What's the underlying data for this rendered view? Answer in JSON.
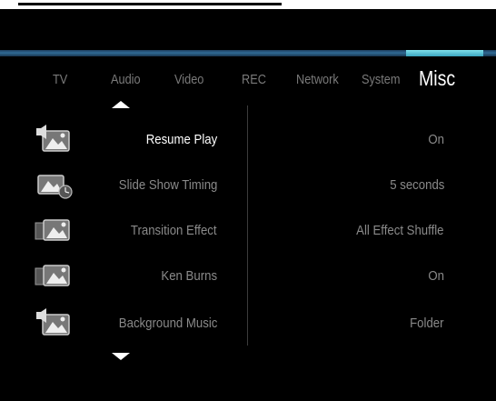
{
  "tabs": [
    {
      "label": "TV"
    },
    {
      "label": "Audio"
    },
    {
      "label": "Video"
    },
    {
      "label": "REC"
    },
    {
      "label": "Network"
    },
    {
      "label": "System"
    },
    {
      "label": "Misc",
      "active": true
    }
  ],
  "settings": [
    {
      "label": "Resume Play",
      "value": "On",
      "icon": "speaker-photo-icon",
      "selected": true
    },
    {
      "label": "Slide Show Timing",
      "value": "5 seconds",
      "icon": "photo-clock-icon"
    },
    {
      "label": "Transition Effect",
      "value": "All Effect Shuffle",
      "icon": "photo-transition-icon"
    },
    {
      "label": "Ken Burns",
      "value": "On",
      "icon": "photo-transition-icon"
    },
    {
      "label": "Background Music",
      "value": "Folder",
      "icon": "speaker-photo-icon"
    }
  ],
  "colors": {
    "accent": "#5fc4d8",
    "active_text": "#ffffff",
    "inactive_text": "#8a8a8a"
  }
}
